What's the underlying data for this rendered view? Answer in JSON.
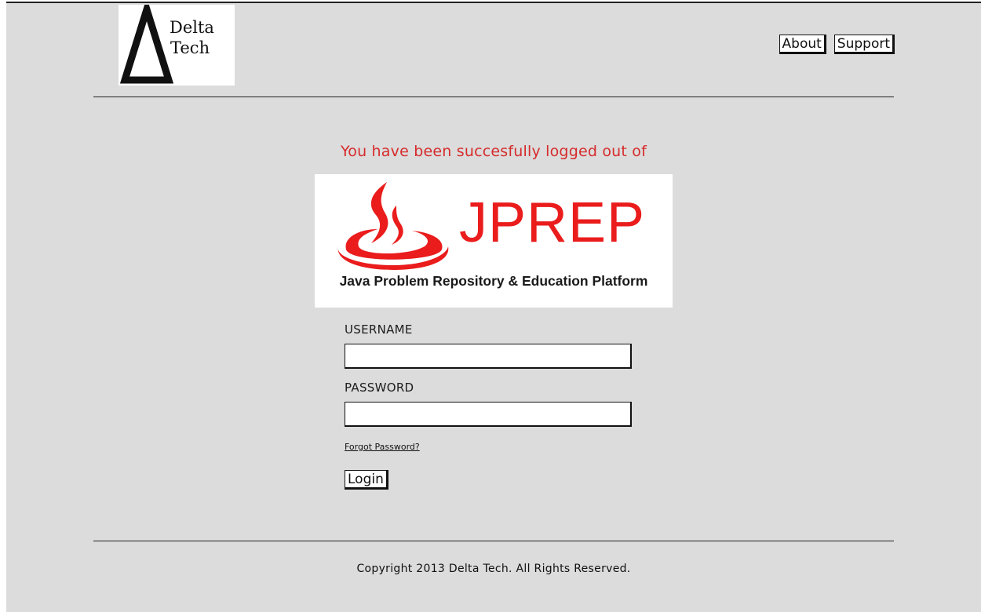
{
  "header": {
    "brand": {
      "line1": "Delta",
      "line2": "Tech",
      "logo_icon": "delta-triangle-icon"
    },
    "nav": {
      "about_label": "About",
      "support_label": "Support"
    }
  },
  "main": {
    "logout_message": "You have been succesfully logged out of",
    "product_logo": {
      "name": "JPREP",
      "tagline": "Java Problem Repository & Education Platform",
      "icon": "java-flame-cup-icon",
      "brand_color": "#ea1c1c"
    },
    "form": {
      "username_label": "USERNAME",
      "username_value": "",
      "password_label": "PASSWORD",
      "password_value": "",
      "forgot_password_label": "Forgot Password?",
      "login_label": "Login"
    }
  },
  "footer": {
    "copyright": "Copyright 2013 Delta Tech. All Rights Reserved."
  },
  "colors": {
    "background": "#dcdcdc",
    "message": "#d62b2b",
    "accent": "#ea1c1c"
  }
}
